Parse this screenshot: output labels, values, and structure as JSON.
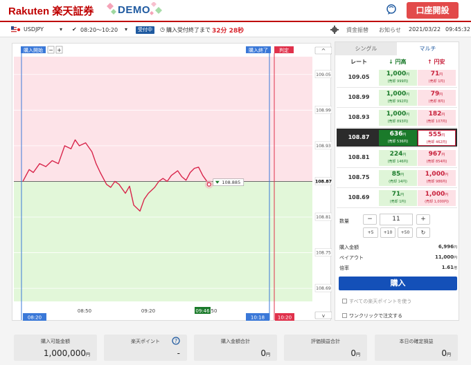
{
  "header": {
    "brand": "Rakuten 楽天証券",
    "demo": "DEMO",
    "open_account": "口座開設"
  },
  "toolbar": {
    "currency_pair": "USDJPY",
    "time_slot": "08:20〜10:20",
    "status_badge": "受付中",
    "until_label": "購入受付終了まで",
    "countdown": "32分 28秒",
    "funds_move": "資金振替",
    "notice": "お知らせ",
    "date": "2021/03/22",
    "time": "09:45:32"
  },
  "chart_labels": {
    "start": "購入開始",
    "end": "購入終了",
    "judge": "判定",
    "start_time": "08:20",
    "end_time": "10:18",
    "judge_time": "10:20",
    "current_time": "09:46",
    "current_time_suffix": "50",
    "price_tag": "108.885"
  },
  "chart_data": {
    "type": "line",
    "y_ticks": [
      "109.05",
      "108.99",
      "108.93",
      "108.87",
      "108.81",
      "108.75",
      "108.69"
    ],
    "x_ticks": [
      "08:50",
      "09:20"
    ],
    "ylim": [
      108.668,
      109.08
    ],
    "threshold": 108.87,
    "series": [
      {
        "x": [
          0,
          3,
          5,
          8,
          11,
          14,
          17,
          20,
          23,
          25,
          27,
          30,
          33,
          35,
          37,
          40,
          42,
          44,
          46,
          49,
          51,
          53,
          56,
          58,
          60,
          63,
          65,
          67,
          69,
          71,
          74,
          76,
          78,
          80,
          82,
          84,
          86,
          89
        ],
        "y": [
          108.87,
          108.89,
          108.885,
          108.9,
          108.895,
          108.905,
          108.9,
          108.93,
          108.925,
          108.94,
          108.93,
          108.935,
          108.92,
          108.9,
          108.885,
          108.865,
          108.86,
          108.87,
          108.865,
          108.85,
          108.862,
          108.83,
          108.82,
          108.84,
          108.85,
          108.86,
          108.87,
          108.875,
          108.87,
          108.88,
          108.888,
          108.878,
          108.872,
          108.885,
          108.892,
          108.894,
          108.88,
          108.865
        ]
      }
    ]
  },
  "tabs": {
    "single": "シングル",
    "multi": "マルチ"
  },
  "rate_table": {
    "col_rate": "レート",
    "col_high": "円高",
    "col_low": "円安",
    "unit": "円",
    "rows": [
      {
        "rate": "109.05",
        "high": "1,000",
        "high_sub": "(売却 999円)",
        "low": "71",
        "low_sub": "(売却 1円)"
      },
      {
        "rate": "108.99",
        "high": "1,000",
        "high_sub": "(売却 992円)",
        "low": "79",
        "low_sub": "(売却 8円)"
      },
      {
        "rate": "108.93",
        "high": "1,000",
        "high_sub": "(売却 893円)",
        "low": "182",
        "low_sub": "(売却 107円)"
      },
      {
        "rate": "108.87",
        "high": "636",
        "high_sub": "(売却 536円)",
        "low": "555",
        "low_sub": "(売却 462円)"
      },
      {
        "rate": "108.81",
        "high": "224",
        "high_sub": "(売却 146円)",
        "low": "967",
        "low_sub": "(売却 854円)"
      },
      {
        "rate": "108.75",
        "high": "85",
        "high_sub": "(売却 14円)",
        "low": "1,000",
        "low_sub": "(売却 986円)"
      },
      {
        "rate": "108.69",
        "high": "71",
        "high_sub": "(売却 1円)",
        "low": "1,000",
        "low_sub": "(売却 1,000円)"
      }
    ]
  },
  "order": {
    "qty_label": "数量",
    "minus": "−",
    "plus": "+",
    "qty": "11",
    "add5": "+5",
    "add10": "+10",
    "add50": "+50",
    "reset": "↻",
    "amount_label": "購入金額",
    "amount": "6,996",
    "payout_label": "ペイアウト",
    "payout": "11,000",
    "ratio_label": "倍率",
    "ratio": "1.61",
    "ratio_unit": "倍",
    "yen": "円",
    "buy": "購入",
    "use_points": "すべての楽天ポイントを使う",
    "one_click": "ワンクリックで注文する"
  },
  "bottom": [
    {
      "label": "購入可能金額",
      "value": "1,000,000",
      "unit": "円"
    },
    {
      "label": "楽天ポイント",
      "value": "-",
      "unit": ""
    },
    {
      "label": "購入金額合計",
      "value": "0",
      "unit": "円"
    },
    {
      "label": "評価損益合計",
      "value": "0",
      "unit": "円"
    },
    {
      "label": "本日の確定損益",
      "value": "0",
      "unit": "円"
    }
  ]
}
